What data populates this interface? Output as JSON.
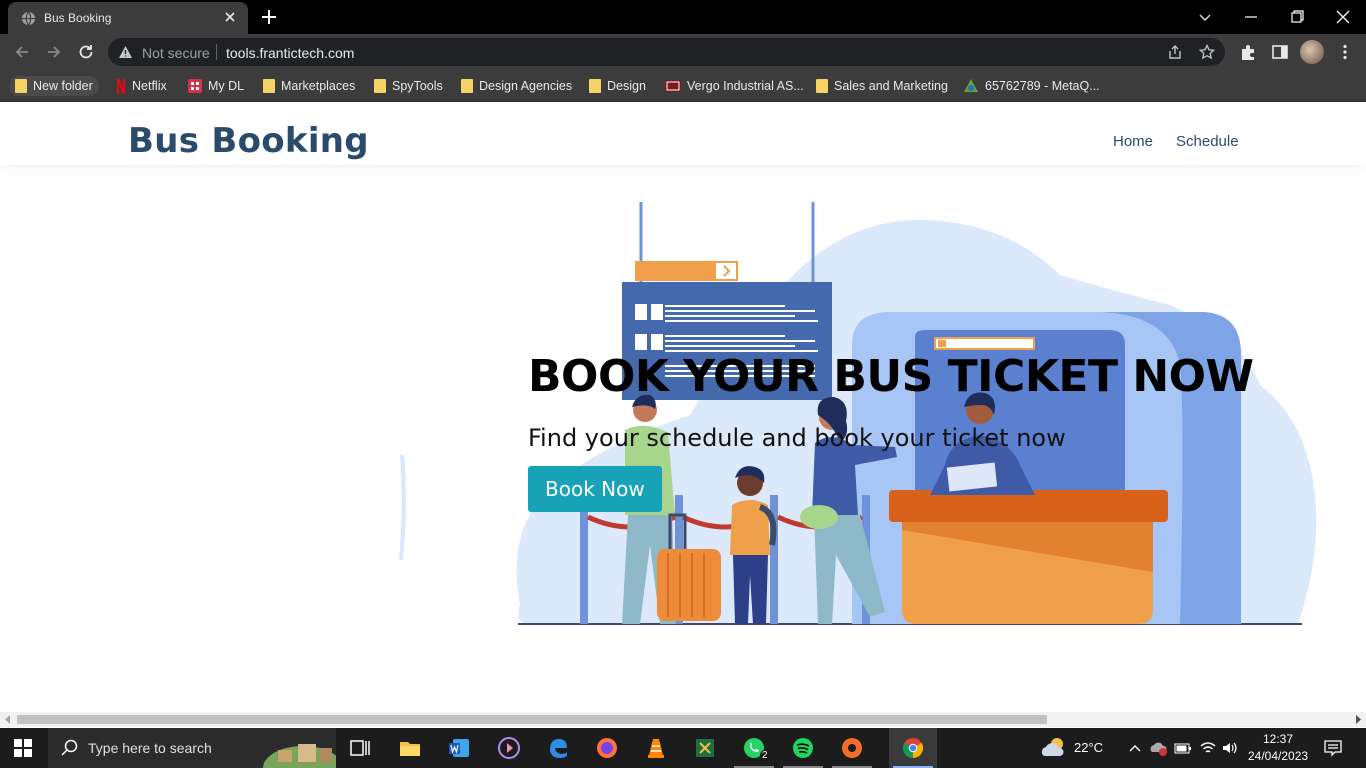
{
  "browser": {
    "tab_title": "Bus Booking",
    "security_label": "Not secure",
    "url": "tools.frantictech.com",
    "bookmarks": [
      {
        "label": "New folder",
        "icon": "folder-icon"
      },
      {
        "label": "Netflix",
        "icon": "netflix-icon"
      },
      {
        "label": "My DL",
        "icon": "app-icon"
      },
      {
        "label": "Marketplaces",
        "icon": "folder-icon"
      },
      {
        "label": "SpyTools",
        "icon": "folder-icon"
      },
      {
        "label": "Design Agencies",
        "icon": "folder-icon"
      },
      {
        "label": "Design",
        "icon": "folder-icon"
      },
      {
        "label": "Vergo Industrial AS...",
        "icon": "site-icon"
      },
      {
        "label": "Sales and Marketing",
        "icon": "folder-icon"
      },
      {
        "label": "65762789 - MetaQ...",
        "icon": "metaquotes-icon"
      }
    ]
  },
  "site": {
    "logo": "Bus Booking",
    "nav": {
      "home": "Home",
      "schedule": "Schedule"
    },
    "hero": {
      "title": "BOOK YOUR BUS TICKET NOW",
      "subtitle": "Find your schedule and book your ticket now",
      "cta": "Book Now"
    }
  },
  "taskbar": {
    "search_placeholder": "Type here to search",
    "weather": "22°C",
    "time": "12:37",
    "date": "24/04/2023",
    "whatsapp_badge": "2"
  },
  "colors": {
    "brand": "#2b4b6a",
    "cta": "#17a2b8",
    "blob": "#d6e6fb",
    "counter": "#f0a04b"
  }
}
